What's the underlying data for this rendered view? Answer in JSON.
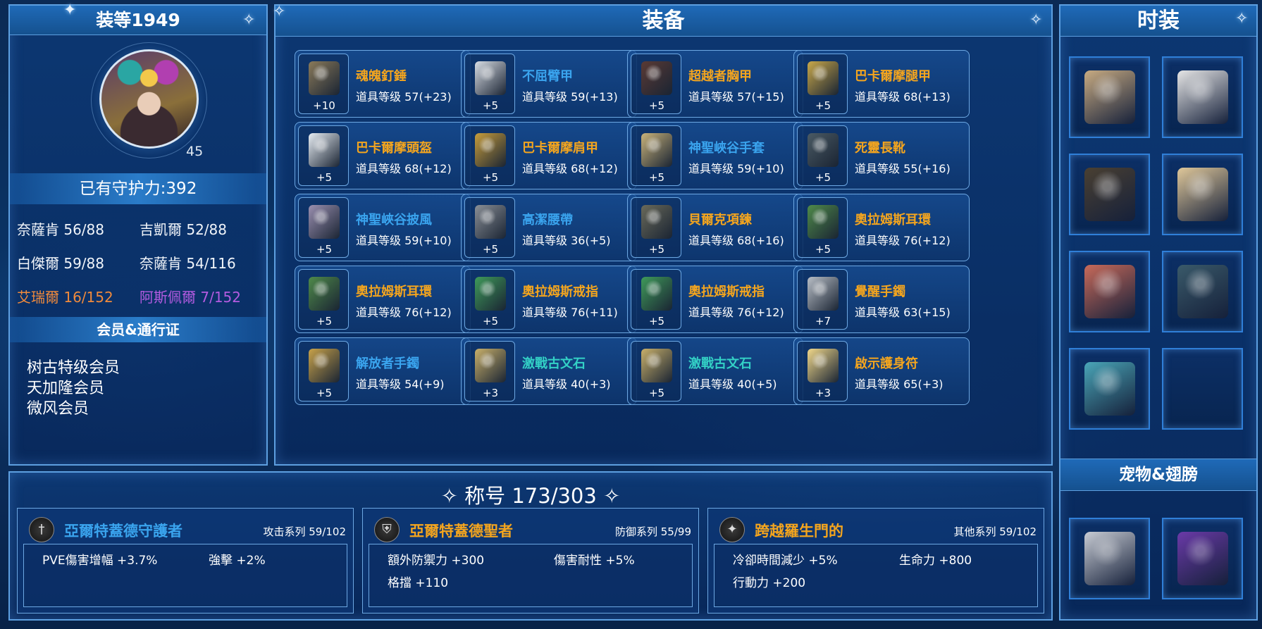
{
  "left_panel": {
    "title": "装等1949",
    "level": "45",
    "guard_power": "已有守护力:392",
    "stats": [
      {
        "label": "奈薩肯 56/88",
        "color": "#f1f5fa"
      },
      {
        "label": "吉凱爾 52/88",
        "color": "#f1f5fa"
      },
      {
        "label": "白傑爾 59/88",
        "color": "#f1f5fa"
      },
      {
        "label": "奈薩肯 54/116",
        "color": "#f1f5fa"
      },
      {
        "label": "艾瑞爾 16/152",
        "color": "#f08a3c"
      },
      {
        "label": "阿斯佩爾 7/152",
        "color": "#b35be0"
      }
    ],
    "membership_title": "会员&通行证",
    "memberships": [
      "树古特级会员",
      "天加隆会员",
      "微风会员"
    ]
  },
  "equipment": {
    "title": "装备",
    "items": [
      {
        "name": "魂魄釘錘",
        "level": "道具等级 57(+23)",
        "plus": "+10",
        "color": "orange",
        "icon": "mace-icon"
      },
      {
        "name": "不屈臂甲",
        "level": "道具等级 59(+13)",
        "plus": "+5",
        "color": "blue",
        "icon": "arm-guard-icon"
      },
      {
        "name": "超越者胸甲",
        "level": "道具等级 57(+15)",
        "plus": "+5",
        "color": "orange",
        "icon": "chest-armor-icon"
      },
      {
        "name": "巴卡爾摩腿甲",
        "level": "道具等级 68(+13)",
        "plus": "+5",
        "color": "orange",
        "icon": "leg-armor-icon"
      },
      {
        "name": "巴卡爾摩頭盔",
        "level": "道具等级 68(+12)",
        "plus": "+5",
        "color": "orange",
        "icon": "helmet-icon"
      },
      {
        "name": "巴卡爾摩肩甲",
        "level": "道具等级 68(+12)",
        "plus": "+5",
        "color": "orange",
        "icon": "shoulder-armor-icon"
      },
      {
        "name": "神聖峽谷手套",
        "level": "道具等级 59(+10)",
        "plus": "+5",
        "color": "blue",
        "icon": "gloves-icon"
      },
      {
        "name": "死靈長靴",
        "level": "道具等级 55(+16)",
        "plus": "+5",
        "color": "orange",
        "icon": "boots-icon"
      },
      {
        "name": "神聖峽谷披風",
        "level": "道具等级 59(+10)",
        "plus": "+5",
        "color": "blue",
        "icon": "cape-icon"
      },
      {
        "name": "高潔腰帶",
        "level": "道具等级 36(+5)",
        "plus": "+5",
        "color": "blue",
        "icon": "belt-icon"
      },
      {
        "name": "貝爾克項鍊",
        "level": "道具等级 68(+16)",
        "plus": "+5",
        "color": "orange",
        "icon": "necklace-icon"
      },
      {
        "name": "奧拉姆斯耳環",
        "level": "道具等级 76(+12)",
        "plus": "+5",
        "color": "orange",
        "icon": "earring-icon"
      },
      {
        "name": "奧拉姆斯耳環",
        "level": "道具等级 76(+12)",
        "plus": "+5",
        "color": "orange",
        "icon": "earring-icon"
      },
      {
        "name": "奧拉姆斯戒指",
        "level": "道具等级 76(+11)",
        "plus": "+5",
        "color": "orange",
        "icon": "ring-icon"
      },
      {
        "name": "奧拉姆斯戒指",
        "level": "道具等级 76(+12)",
        "plus": "+5",
        "color": "orange",
        "icon": "ring-icon"
      },
      {
        "name": "覺醒手鐲",
        "level": "道具等级 63(+15)",
        "plus": "+7",
        "color": "orange",
        "icon": "bracelet-icon"
      },
      {
        "name": "解放者手鐲",
        "level": "道具等级 54(+9)",
        "plus": "+5",
        "color": "blue",
        "icon": "bracelet-icon"
      },
      {
        "name": "激戰古文石",
        "level": "道具等级 40(+3)",
        "plus": "+3",
        "color": "teal",
        "icon": "rune-stone-icon"
      },
      {
        "name": "激戰古文石",
        "level": "道具等级 40(+5)",
        "plus": "+5",
        "color": "teal",
        "icon": "rune-stone-icon"
      },
      {
        "name": "啟示護身符",
        "level": "道具等级 65(+3)",
        "plus": "+3",
        "color": "orange",
        "icon": "amulet-icon"
      }
    ]
  },
  "fashion": {
    "title": "时装",
    "slots": [
      "hat-costume-icon",
      "pants-costume-icon",
      "boots-costume-icon",
      "gloves-costume-icon",
      "cape-costume-icon",
      "armor-costume-icon",
      "feather-mask-costume-icon",
      "empty-slot"
    ],
    "pet_wing_title": "宠物&翅膀",
    "pet_slots": [
      "pet-icon",
      "wings-icon"
    ]
  },
  "titles": {
    "heading": "称号 173/303",
    "cards": [
      {
        "name": "亞爾特蓋德守護者",
        "category": "攻击系列 59/102",
        "name_color": "#3aa4ee",
        "icon": "sword-icon",
        "effects": [
          "PVE傷害增幅 +3.7%",
          "強擊 +2%"
        ]
      },
      {
        "name": "亞爾特蓋德聖者",
        "category": "防御系列 55/99",
        "name_color": "#f4a51e",
        "icon": "shield-icon",
        "effects": [
          "額外防禦力 +300",
          "傷害耐性 +5%",
          "格擋 +110"
        ]
      },
      {
        "name": "跨越羅生門的",
        "category": "其他系列 59/102",
        "name_color": "#f4a51e",
        "icon": "star-badge-icon",
        "effects": [
          "冷卻時間減少 +5%",
          "生命力 +800",
          "行動力 +200"
        ]
      }
    ]
  },
  "colors": {
    "orange": "#f4a51e",
    "blue": "#3aa4ee",
    "teal": "#33d1c6",
    "border": "#5d9fe0"
  }
}
